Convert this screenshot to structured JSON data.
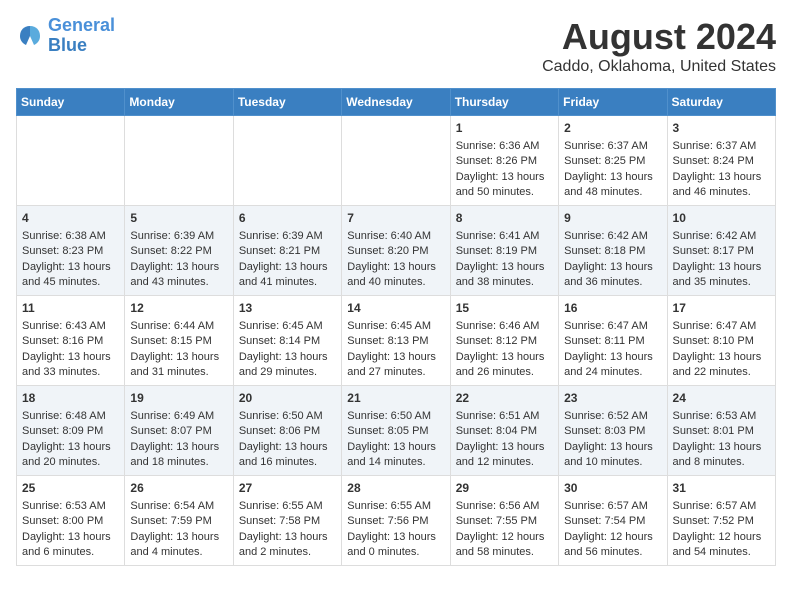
{
  "header": {
    "logo_line1": "General",
    "logo_line2": "Blue",
    "title": "August 2024",
    "subtitle": "Caddo, Oklahoma, United States"
  },
  "calendar": {
    "days_of_week": [
      "Sunday",
      "Monday",
      "Tuesday",
      "Wednesday",
      "Thursday",
      "Friday",
      "Saturday"
    ],
    "weeks": [
      [
        {
          "day": "",
          "content": ""
        },
        {
          "day": "",
          "content": ""
        },
        {
          "day": "",
          "content": ""
        },
        {
          "day": "",
          "content": ""
        },
        {
          "day": "1",
          "content": "Sunrise: 6:36 AM\nSunset: 8:26 PM\nDaylight: 13 hours\nand 50 minutes."
        },
        {
          "day": "2",
          "content": "Sunrise: 6:37 AM\nSunset: 8:25 PM\nDaylight: 13 hours\nand 48 minutes."
        },
        {
          "day": "3",
          "content": "Sunrise: 6:37 AM\nSunset: 8:24 PM\nDaylight: 13 hours\nand 46 minutes."
        }
      ],
      [
        {
          "day": "4",
          "content": "Sunrise: 6:38 AM\nSunset: 8:23 PM\nDaylight: 13 hours\nand 45 minutes."
        },
        {
          "day": "5",
          "content": "Sunrise: 6:39 AM\nSunset: 8:22 PM\nDaylight: 13 hours\nand 43 minutes."
        },
        {
          "day": "6",
          "content": "Sunrise: 6:39 AM\nSunset: 8:21 PM\nDaylight: 13 hours\nand 41 minutes."
        },
        {
          "day": "7",
          "content": "Sunrise: 6:40 AM\nSunset: 8:20 PM\nDaylight: 13 hours\nand 40 minutes."
        },
        {
          "day": "8",
          "content": "Sunrise: 6:41 AM\nSunset: 8:19 PM\nDaylight: 13 hours\nand 38 minutes."
        },
        {
          "day": "9",
          "content": "Sunrise: 6:42 AM\nSunset: 8:18 PM\nDaylight: 13 hours\nand 36 minutes."
        },
        {
          "day": "10",
          "content": "Sunrise: 6:42 AM\nSunset: 8:17 PM\nDaylight: 13 hours\nand 35 minutes."
        }
      ],
      [
        {
          "day": "11",
          "content": "Sunrise: 6:43 AM\nSunset: 8:16 PM\nDaylight: 13 hours\nand 33 minutes."
        },
        {
          "day": "12",
          "content": "Sunrise: 6:44 AM\nSunset: 8:15 PM\nDaylight: 13 hours\nand 31 minutes."
        },
        {
          "day": "13",
          "content": "Sunrise: 6:45 AM\nSunset: 8:14 PM\nDaylight: 13 hours\nand 29 minutes."
        },
        {
          "day": "14",
          "content": "Sunrise: 6:45 AM\nSunset: 8:13 PM\nDaylight: 13 hours\nand 27 minutes."
        },
        {
          "day": "15",
          "content": "Sunrise: 6:46 AM\nSunset: 8:12 PM\nDaylight: 13 hours\nand 26 minutes."
        },
        {
          "day": "16",
          "content": "Sunrise: 6:47 AM\nSunset: 8:11 PM\nDaylight: 13 hours\nand 24 minutes."
        },
        {
          "day": "17",
          "content": "Sunrise: 6:47 AM\nSunset: 8:10 PM\nDaylight: 13 hours\nand 22 minutes."
        }
      ],
      [
        {
          "day": "18",
          "content": "Sunrise: 6:48 AM\nSunset: 8:09 PM\nDaylight: 13 hours\nand 20 minutes."
        },
        {
          "day": "19",
          "content": "Sunrise: 6:49 AM\nSunset: 8:07 PM\nDaylight: 13 hours\nand 18 minutes."
        },
        {
          "day": "20",
          "content": "Sunrise: 6:50 AM\nSunset: 8:06 PM\nDaylight: 13 hours\nand 16 minutes."
        },
        {
          "day": "21",
          "content": "Sunrise: 6:50 AM\nSunset: 8:05 PM\nDaylight: 13 hours\nand 14 minutes."
        },
        {
          "day": "22",
          "content": "Sunrise: 6:51 AM\nSunset: 8:04 PM\nDaylight: 13 hours\nand 12 minutes."
        },
        {
          "day": "23",
          "content": "Sunrise: 6:52 AM\nSunset: 8:03 PM\nDaylight: 13 hours\nand 10 minutes."
        },
        {
          "day": "24",
          "content": "Sunrise: 6:53 AM\nSunset: 8:01 PM\nDaylight: 13 hours\nand 8 minutes."
        }
      ],
      [
        {
          "day": "25",
          "content": "Sunrise: 6:53 AM\nSunset: 8:00 PM\nDaylight: 13 hours\nand 6 minutes."
        },
        {
          "day": "26",
          "content": "Sunrise: 6:54 AM\nSunset: 7:59 PM\nDaylight: 13 hours\nand 4 minutes."
        },
        {
          "day": "27",
          "content": "Sunrise: 6:55 AM\nSunset: 7:58 PM\nDaylight: 13 hours\nand 2 minutes."
        },
        {
          "day": "28",
          "content": "Sunrise: 6:55 AM\nSunset: 7:56 PM\nDaylight: 13 hours\nand 0 minutes."
        },
        {
          "day": "29",
          "content": "Sunrise: 6:56 AM\nSunset: 7:55 PM\nDaylight: 12 hours\nand 58 minutes."
        },
        {
          "day": "30",
          "content": "Sunrise: 6:57 AM\nSunset: 7:54 PM\nDaylight: 12 hours\nand 56 minutes."
        },
        {
          "day": "31",
          "content": "Sunrise: 6:57 AM\nSunset: 7:52 PM\nDaylight: 12 hours\nand 54 minutes."
        }
      ]
    ]
  }
}
